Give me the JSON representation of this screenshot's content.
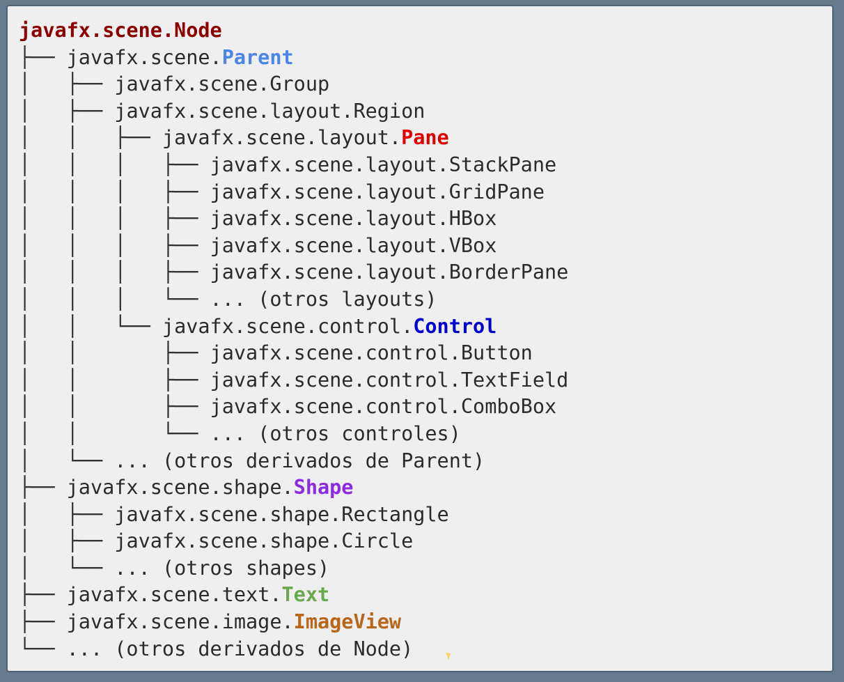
{
  "colors": {
    "root": "#8b0000",
    "parent": "#4a86e8",
    "pane": "#e00000",
    "control": "#0000cc",
    "shape": "#8a2be2",
    "text": "#6aa84f",
    "imageview": "#b8661a"
  },
  "tree": {
    "lines": [
      {
        "prefix": "",
        "base": "",
        "highlight": "javafx.scene.Node",
        "hl_color": "root",
        "bold_all": true
      },
      {
        "prefix": "├── ",
        "base": "javafx.scene.",
        "highlight": "Parent",
        "hl_color": "parent"
      },
      {
        "prefix": "│   ├── ",
        "base": "javafx.scene.Group",
        "highlight": "",
        "hl_color": ""
      },
      {
        "prefix": "│   ├── ",
        "base": "javafx.scene.layout.Region",
        "highlight": "",
        "hl_color": ""
      },
      {
        "prefix": "│   │   ├── ",
        "base": "javafx.scene.layout.",
        "highlight": "Pane",
        "hl_color": "pane"
      },
      {
        "prefix": "│   │   │   ├── ",
        "base": "javafx.scene.layout.StackPane",
        "highlight": "",
        "hl_color": ""
      },
      {
        "prefix": "│   │   │   ├── ",
        "base": "javafx.scene.layout.GridPane",
        "highlight": "",
        "hl_color": ""
      },
      {
        "prefix": "│   │   │   ├── ",
        "base": "javafx.scene.layout.HBox",
        "highlight": "",
        "hl_color": ""
      },
      {
        "prefix": "│   │   │   ├── ",
        "base": "javafx.scene.layout.VBox",
        "highlight": "",
        "hl_color": ""
      },
      {
        "prefix": "│   │   │   ├── ",
        "base": "javafx.scene.layout.BorderPane",
        "highlight": "",
        "hl_color": ""
      },
      {
        "prefix": "│   │   │   └── ",
        "base": "... (otros layouts)",
        "highlight": "",
        "hl_color": ""
      },
      {
        "prefix": "│   │   └── ",
        "base": "javafx.scene.control.",
        "highlight": "Control",
        "hl_color": "control"
      },
      {
        "prefix": "│   │       ├── ",
        "base": "javafx.scene.control.Button",
        "highlight": "",
        "hl_color": ""
      },
      {
        "prefix": "│   │       ├── ",
        "base": "javafx.scene.control.TextField",
        "highlight": "",
        "hl_color": ""
      },
      {
        "prefix": "│   │       ├── ",
        "base": "javafx.scene.control.ComboBox",
        "highlight": "",
        "hl_color": ""
      },
      {
        "prefix": "│   │       └── ",
        "base": "... (otros controles)",
        "highlight": "",
        "hl_color": ""
      },
      {
        "prefix": "│   └── ",
        "base": "... (otros derivados de Parent)",
        "highlight": "",
        "hl_color": ""
      },
      {
        "prefix": "├── ",
        "base": "javafx.scene.shape.",
        "highlight": "Shape",
        "hl_color": "shape"
      },
      {
        "prefix": "│   ├── ",
        "base": "javafx.scene.shape.Rectangle",
        "highlight": "",
        "hl_color": ""
      },
      {
        "prefix": "│   ├── ",
        "base": "javafx.scene.shape.Circle",
        "highlight": "",
        "hl_color": ""
      },
      {
        "prefix": "│   └── ",
        "base": "... (otros shapes)",
        "highlight": "",
        "hl_color": ""
      },
      {
        "prefix": "├── ",
        "base": "javafx.scene.text.",
        "highlight": "Text",
        "hl_color": "text"
      },
      {
        "prefix": "├── ",
        "base": "javafx.scene.image.",
        "highlight": "ImageView",
        "hl_color": "imageview"
      },
      {
        "prefix": "└── ",
        "base": "... (otros derivados de Node)",
        "highlight": "",
        "hl_color": ""
      }
    ]
  }
}
